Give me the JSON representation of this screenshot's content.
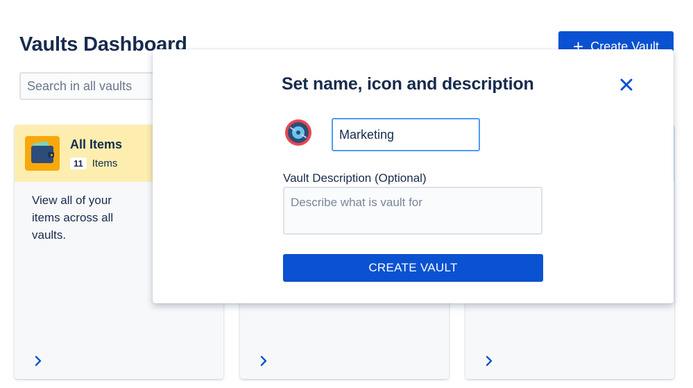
{
  "header": {
    "title": "Vaults Dashboard",
    "create_button_label": "Create Vault",
    "create_button_icon": "plus-icon"
  },
  "search": {
    "placeholder": "Search in all vaults"
  },
  "cards": [
    {
      "title": "All Items",
      "count": "11",
      "count_label": "Items",
      "description": "View all of your items across all vaults.",
      "icon": "wallet-icon"
    },
    {
      "title": "",
      "description": ""
    },
    {
      "title": "",
      "description": ""
    }
  ],
  "modal": {
    "title": "Set name, icon and description",
    "name_value": "Marketing",
    "description_label": "Vault Description (Optional)",
    "description_placeholder": "Describe what is vault for",
    "submit_label": "CREATE VAULT",
    "vault_icon": "vinyl-record-icon",
    "close_icon": "close-icon"
  },
  "colors": {
    "primary": "#0a52d1",
    "text": "#172b4d",
    "card_header_yellow": "#fdeeb0",
    "card_header_blue": "#c7eafb",
    "focus_border": "#4c9aff"
  }
}
